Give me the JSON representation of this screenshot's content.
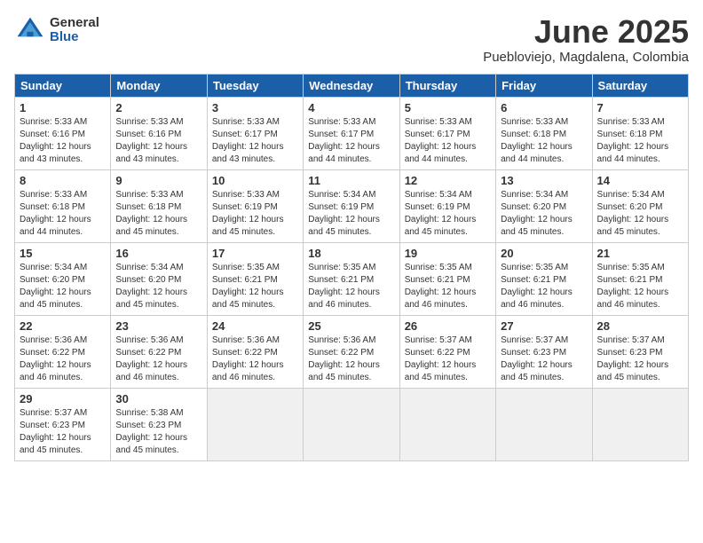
{
  "header": {
    "logo_general": "General",
    "logo_blue": "Blue",
    "month": "June 2025",
    "location": "Puebloviejo, Magdalena, Colombia"
  },
  "weekdays": [
    "Sunday",
    "Monday",
    "Tuesday",
    "Wednesday",
    "Thursday",
    "Friday",
    "Saturday"
  ],
  "weeks": [
    [
      {
        "day": "1",
        "sunrise": "Sunrise: 5:33 AM",
        "sunset": "Sunset: 6:16 PM",
        "daylight": "Daylight: 12 hours and 43 minutes."
      },
      {
        "day": "2",
        "sunrise": "Sunrise: 5:33 AM",
        "sunset": "Sunset: 6:16 PM",
        "daylight": "Daylight: 12 hours and 43 minutes."
      },
      {
        "day": "3",
        "sunrise": "Sunrise: 5:33 AM",
        "sunset": "Sunset: 6:17 PM",
        "daylight": "Daylight: 12 hours and 43 minutes."
      },
      {
        "day": "4",
        "sunrise": "Sunrise: 5:33 AM",
        "sunset": "Sunset: 6:17 PM",
        "daylight": "Daylight: 12 hours and 44 minutes."
      },
      {
        "day": "5",
        "sunrise": "Sunrise: 5:33 AM",
        "sunset": "Sunset: 6:17 PM",
        "daylight": "Daylight: 12 hours and 44 minutes."
      },
      {
        "day": "6",
        "sunrise": "Sunrise: 5:33 AM",
        "sunset": "Sunset: 6:18 PM",
        "daylight": "Daylight: 12 hours and 44 minutes."
      },
      {
        "day": "7",
        "sunrise": "Sunrise: 5:33 AM",
        "sunset": "Sunset: 6:18 PM",
        "daylight": "Daylight: 12 hours and 44 minutes."
      }
    ],
    [
      {
        "day": "8",
        "sunrise": "Sunrise: 5:33 AM",
        "sunset": "Sunset: 6:18 PM",
        "daylight": "Daylight: 12 hours and 44 minutes."
      },
      {
        "day": "9",
        "sunrise": "Sunrise: 5:33 AM",
        "sunset": "Sunset: 6:18 PM",
        "daylight": "Daylight: 12 hours and 45 minutes."
      },
      {
        "day": "10",
        "sunrise": "Sunrise: 5:33 AM",
        "sunset": "Sunset: 6:19 PM",
        "daylight": "Daylight: 12 hours and 45 minutes."
      },
      {
        "day": "11",
        "sunrise": "Sunrise: 5:34 AM",
        "sunset": "Sunset: 6:19 PM",
        "daylight": "Daylight: 12 hours and 45 minutes."
      },
      {
        "day": "12",
        "sunrise": "Sunrise: 5:34 AM",
        "sunset": "Sunset: 6:19 PM",
        "daylight": "Daylight: 12 hours and 45 minutes."
      },
      {
        "day": "13",
        "sunrise": "Sunrise: 5:34 AM",
        "sunset": "Sunset: 6:20 PM",
        "daylight": "Daylight: 12 hours and 45 minutes."
      },
      {
        "day": "14",
        "sunrise": "Sunrise: 5:34 AM",
        "sunset": "Sunset: 6:20 PM",
        "daylight": "Daylight: 12 hours and 45 minutes."
      }
    ],
    [
      {
        "day": "15",
        "sunrise": "Sunrise: 5:34 AM",
        "sunset": "Sunset: 6:20 PM",
        "daylight": "Daylight: 12 hours and 45 minutes."
      },
      {
        "day": "16",
        "sunrise": "Sunrise: 5:34 AM",
        "sunset": "Sunset: 6:20 PM",
        "daylight": "Daylight: 12 hours and 45 minutes."
      },
      {
        "day": "17",
        "sunrise": "Sunrise: 5:35 AM",
        "sunset": "Sunset: 6:21 PM",
        "daylight": "Daylight: 12 hours and 45 minutes."
      },
      {
        "day": "18",
        "sunrise": "Sunrise: 5:35 AM",
        "sunset": "Sunset: 6:21 PM",
        "daylight": "Daylight: 12 hours and 46 minutes."
      },
      {
        "day": "19",
        "sunrise": "Sunrise: 5:35 AM",
        "sunset": "Sunset: 6:21 PM",
        "daylight": "Daylight: 12 hours and 46 minutes."
      },
      {
        "day": "20",
        "sunrise": "Sunrise: 5:35 AM",
        "sunset": "Sunset: 6:21 PM",
        "daylight": "Daylight: 12 hours and 46 minutes."
      },
      {
        "day": "21",
        "sunrise": "Sunrise: 5:35 AM",
        "sunset": "Sunset: 6:21 PM",
        "daylight": "Daylight: 12 hours and 46 minutes."
      }
    ],
    [
      {
        "day": "22",
        "sunrise": "Sunrise: 5:36 AM",
        "sunset": "Sunset: 6:22 PM",
        "daylight": "Daylight: 12 hours and 46 minutes."
      },
      {
        "day": "23",
        "sunrise": "Sunrise: 5:36 AM",
        "sunset": "Sunset: 6:22 PM",
        "daylight": "Daylight: 12 hours and 46 minutes."
      },
      {
        "day": "24",
        "sunrise": "Sunrise: 5:36 AM",
        "sunset": "Sunset: 6:22 PM",
        "daylight": "Daylight: 12 hours and 46 minutes."
      },
      {
        "day": "25",
        "sunrise": "Sunrise: 5:36 AM",
        "sunset": "Sunset: 6:22 PM",
        "daylight": "Daylight: 12 hours and 45 minutes."
      },
      {
        "day": "26",
        "sunrise": "Sunrise: 5:37 AM",
        "sunset": "Sunset: 6:22 PM",
        "daylight": "Daylight: 12 hours and 45 minutes."
      },
      {
        "day": "27",
        "sunrise": "Sunrise: 5:37 AM",
        "sunset": "Sunset: 6:23 PM",
        "daylight": "Daylight: 12 hours and 45 minutes."
      },
      {
        "day": "28",
        "sunrise": "Sunrise: 5:37 AM",
        "sunset": "Sunset: 6:23 PM",
        "daylight": "Daylight: 12 hours and 45 minutes."
      }
    ],
    [
      {
        "day": "29",
        "sunrise": "Sunrise: 5:37 AM",
        "sunset": "Sunset: 6:23 PM",
        "daylight": "Daylight: 12 hours and 45 minutes."
      },
      {
        "day": "30",
        "sunrise": "Sunrise: 5:38 AM",
        "sunset": "Sunset: 6:23 PM",
        "daylight": "Daylight: 12 hours and 45 minutes."
      },
      {
        "day": "",
        "sunrise": "",
        "sunset": "",
        "daylight": ""
      },
      {
        "day": "",
        "sunrise": "",
        "sunset": "",
        "daylight": ""
      },
      {
        "day": "",
        "sunrise": "",
        "sunset": "",
        "daylight": ""
      },
      {
        "day": "",
        "sunrise": "",
        "sunset": "",
        "daylight": ""
      },
      {
        "day": "",
        "sunrise": "",
        "sunset": "",
        "daylight": ""
      }
    ]
  ]
}
